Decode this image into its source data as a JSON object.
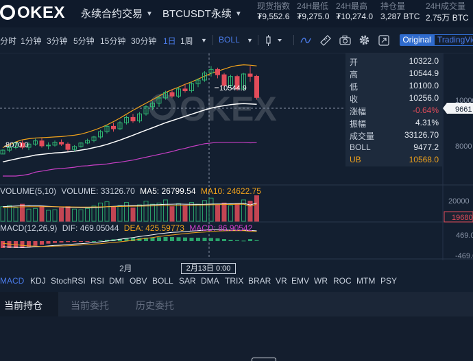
{
  "header": {
    "logo_text": "OKEX",
    "product_menu": "永续合约交易",
    "symbol": "BTCUSDT永续",
    "stats": [
      {
        "label": "现货指数",
        "value": "₮9,552.6"
      },
      {
        "label": "24H最低",
        "value": "₮9,275.0"
      },
      {
        "label": "24H最高",
        "value": "₮10,274.0"
      },
      {
        "label": "持仓量",
        "value": "3,287 BTC"
      },
      {
        "label": "24H成交量",
        "value": "2.75万 BTC"
      }
    ]
  },
  "toolbar": {
    "intervals": [
      "分时",
      "1分钟",
      "3分钟",
      "5分钟",
      "15分钟",
      "30分钟",
      "1日",
      "1周"
    ],
    "active_interval": "1日",
    "indicator": "BOLL",
    "original_label": "Original",
    "tradingview_label": "TradingView"
  },
  "chart": {
    "watermark": "OKEX",
    "high_marker": "10544.9",
    "low_marker": "8070.0",
    "price_tag": "9661",
    "yaxis_labels": [
      "10000",
      "8000"
    ],
    "volume": {
      "label": "VOLUME(5,10)",
      "volume_text": "VOLUME: 33126.70",
      "ma5_text": "MA5: 26799.54",
      "ma10_text": "MA10: 24622.75",
      "axis_label": "20000",
      "tag": "19680"
    },
    "macd": {
      "label": "MACD(12,26,9)",
      "dif_text": "DIF: 469.05044",
      "dea_text": "DEA: 425.59773",
      "macd_text": "MACD: 86.90542",
      "axis_labels": [
        "469.0",
        "-469.0"
      ]
    },
    "xaxis": {
      "month_label": "2月",
      "cursor_label": "2月13日 0:00"
    },
    "colors": {
      "up": "#2fb372",
      "down": "#e24c5a",
      "ub": "#f0a21c",
      "mid": "#ffffff",
      "lb": "#c93fc6",
      "dea": "#f0a21c",
      "macd_label": "#c93fc6"
    }
  },
  "infobox": {
    "rows": [
      {
        "key": "开",
        "value": "10322.0"
      },
      {
        "key": "高",
        "value": "10544.9"
      },
      {
        "key": "低",
        "value": "10100.0"
      },
      {
        "key": "收",
        "value": "10256.0"
      },
      {
        "key": "涨幅",
        "value": "-0.64%"
      },
      {
        "key": "振幅",
        "value": "4.31%"
      },
      {
        "key": "成交量",
        "value": "33126.70"
      },
      {
        "key": "BOLL",
        "value": "9477.2"
      },
      {
        "key": "UB",
        "value": "10568.0"
      }
    ]
  },
  "indicator_tabs": [
    "MACD",
    "KDJ",
    "StochRSI",
    "RSI",
    "DMI",
    "OBV",
    "BOLL",
    "SAR",
    "DMA",
    "TRIX",
    "BRAR",
    "VR",
    "EMV",
    "WR",
    "ROC",
    "MTM",
    "PSY"
  ],
  "bottom_tabs": [
    "当前持仓",
    "当前委托",
    "历史委托"
  ],
  "chart_data": {
    "type": "candlestick",
    "candles": [
      {
        "o": 8070,
        "h": 8200,
        "l": 8070,
        "c": 8180
      },
      {
        "o": 8180,
        "h": 8300,
        "l": 8120,
        "c": 8250
      },
      {
        "o": 8250,
        "h": 8420,
        "l": 8200,
        "c": 8380
      },
      {
        "o": 8380,
        "h": 8450,
        "l": 8200,
        "c": 8260
      },
      {
        "o": 8260,
        "h": 8400,
        "l": 8180,
        "c": 8350
      },
      {
        "o": 8350,
        "h": 8500,
        "l": 8300,
        "c": 8440
      },
      {
        "o": 8440,
        "h": 8520,
        "l": 8250,
        "c": 8300
      },
      {
        "o": 8300,
        "h": 8400,
        "l": 8200,
        "c": 8320
      },
      {
        "o": 8320,
        "h": 8450,
        "l": 8280,
        "c": 8400
      },
      {
        "o": 8400,
        "h": 8480,
        "l": 8300,
        "c": 8350
      },
      {
        "o": 8350,
        "h": 8400,
        "l": 8150,
        "c": 8200
      },
      {
        "o": 8200,
        "h": 8320,
        "l": 8150,
        "c": 8280
      },
      {
        "o": 8280,
        "h": 8400,
        "l": 8250,
        "c": 8380
      },
      {
        "o": 8380,
        "h": 8500,
        "l": 8350,
        "c": 8450
      },
      {
        "o": 8450,
        "h": 8580,
        "l": 8400,
        "c": 8550
      },
      {
        "o": 8550,
        "h": 8750,
        "l": 8500,
        "c": 8700
      },
      {
        "o": 8700,
        "h": 8900,
        "l": 8650,
        "c": 8850
      },
      {
        "o": 8850,
        "h": 8950,
        "l": 8700,
        "c": 8780
      },
      {
        "o": 8780,
        "h": 9000,
        "l": 8750,
        "c": 8950
      },
      {
        "o": 8950,
        "h": 9150,
        "l": 8900,
        "c": 9100
      },
      {
        "o": 9100,
        "h": 9200,
        "l": 8950,
        "c": 9000
      },
      {
        "o": 9000,
        "h": 9250,
        "l": 8950,
        "c": 9200
      },
      {
        "o": 9200,
        "h": 9450,
        "l": 9150,
        "c": 9400
      },
      {
        "o": 9400,
        "h": 9550,
        "l": 9300,
        "c": 9500
      },
      {
        "o": 9500,
        "h": 9700,
        "l": 9400,
        "c": 9650
      },
      {
        "o": 9650,
        "h": 9850,
        "l": 9600,
        "c": 9800
      },
      {
        "o": 9800,
        "h": 9900,
        "l": 9650,
        "c": 9700
      },
      {
        "o": 9700,
        "h": 9950,
        "l": 9650,
        "c": 9900
      },
      {
        "o": 9900,
        "h": 10050,
        "l": 9800,
        "c": 9850
      },
      {
        "o": 9850,
        "h": 10100,
        "l": 9800,
        "c": 10050
      },
      {
        "o": 10050,
        "h": 10200,
        "l": 9950,
        "c": 10150
      },
      {
        "o": 10150,
        "h": 10400,
        "l": 10100,
        "c": 10350
      },
      {
        "o": 10350,
        "h": 10544.9,
        "l": 10250,
        "c": 10450
      },
      {
        "o": 10450,
        "h": 10500,
        "l": 10200,
        "c": 10300
      },
      {
        "o": 10300,
        "h": 10350,
        "l": 9900,
        "c": 10000
      },
      {
        "o": 10000,
        "h": 10300,
        "l": 9950,
        "c": 10250
      },
      {
        "o": 10250,
        "h": 10300,
        "l": 9850,
        "c": 9900
      },
      {
        "o": 9900,
        "h": 10350,
        "l": 9850,
        "c": 10322
      },
      {
        "o": 10322,
        "h": 10544.9,
        "l": 10100,
        "c": 10256
      },
      {
        "o": 10256,
        "h": 10300,
        "l": 9600,
        "c": 9661
      }
    ],
    "boll_mid": [
      7850,
      7890,
      7930,
      7970,
      8000,
      8040,
      8060,
      8080,
      8100,
      8110,
      8130,
      8150,
      8180,
      8210,
      8250,
      8290,
      8340,
      8400,
      8460,
      8530,
      8600,
      8670,
      8740,
      8810,
      8880,
      8950,
      9010,
      9070,
      9130,
      9190,
      9250,
      9310,
      9360,
      9400,
      9430,
      9460,
      9480,
      9490,
      9477,
      9470
    ],
    "boll_ub": [
      8250,
      8330,
      8410,
      8470,
      8500,
      8520,
      8530,
      8540,
      8550,
      8560,
      8580,
      8600,
      8630,
      8680,
      8740,
      8810,
      8890,
      8980,
      9080,
      9190,
      9300,
      9400,
      9500,
      9600,
      9700,
      9800,
      9880,
      9950,
      10030,
      10100,
      10180,
      10260,
      10340,
      10400,
      10460,
      10520,
      10560,
      10580,
      10568,
      10550
    ],
    "boll_lb": [
      7450,
      7450,
      7450,
      7470,
      7500,
      7560,
      7590,
      7620,
      7650,
      7660,
      7680,
      7700,
      7730,
      7740,
      7760,
      7770,
      7790,
      7820,
      7840,
      7870,
      7900,
      7940,
      7980,
      8020,
      8060,
      8100,
      8140,
      8190,
      8230,
      8280,
      8320,
      8360,
      8380,
      8400,
      8400,
      8400,
      8400,
      8400,
      8386,
      8390
    ],
    "volume": [
      24000,
      26000,
      22000,
      28000,
      20000,
      21000,
      25000,
      18000,
      19000,
      22000,
      24000,
      20000,
      19000,
      21000,
      25000,
      30000,
      32000,
      24000,
      26000,
      31000,
      22000,
      27000,
      33000,
      28000,
      30000,
      35000,
      24000,
      29000,
      26000,
      31000,
      28000,
      34000,
      38000,
      27000,
      30000,
      26000,
      29000,
      35000,
      33126.7,
      42000
    ],
    "vol_ma5": [
      24000,
      24500,
      25000,
      25500,
      26000,
      25800,
      25200,
      24500,
      24000,
      23500,
      23000,
      22800,
      22500,
      22300,
      22500,
      23000,
      23800,
      24500,
      25000,
      25500,
      26000,
      26300,
      26800,
      27000,
      27300,
      27800,
      28000,
      28200,
      28000,
      27800,
      27700,
      27800,
      28200,
      28500,
      28500,
      28700,
      29000,
      29500,
      26799.54,
      30000
    ],
    "vol_ma10": [
      23000,
      23200,
      23400,
      23600,
      23800,
      24000,
      24000,
      23900,
      23800,
      23700,
      23600,
      23500,
      23400,
      23400,
      23500,
      23600,
      23800,
      24000,
      24200,
      24400,
      24600,
      24800,
      25000,
      25200,
      25400,
      25600,
      25800,
      26000,
      26200,
      26400,
      26600,
      26800,
      27000,
      27200,
      27400,
      27600,
      27800,
      28000,
      24622.75,
      28300
    ],
    "dif": [
      -250,
      -260,
      -270,
      -280,
      -270,
      -250,
      -230,
      -210,
      -190,
      -170,
      -150,
      -130,
      -110,
      -90,
      -60,
      -30,
      0,
      40,
      80,
      120,
      160,
      200,
      240,
      280,
      320,
      350,
      380,
      400,
      420,
      440,
      460,
      480,
      500,
      500,
      490,
      480,
      470,
      470,
      469.05,
      450
    ],
    "dea": [
      -100,
      -130,
      -160,
      -190,
      -210,
      -220,
      -230,
      -230,
      -220,
      -210,
      -200,
      -185,
      -170,
      -150,
      -130,
      -110,
      -85,
      -60,
      -30,
      0,
      40,
      80,
      120,
      160,
      200,
      240,
      270,
      300,
      330,
      360,
      380,
      400,
      420,
      440,
      450,
      455,
      460,
      462,
      425.6,
      430
    ],
    "macd": [
      -300,
      -300,
      -300,
      -300,
      -250,
      -200,
      -160,
      -110,
      -80,
      -60,
      -40,
      -30,
      -20,
      -10,
      0,
      30,
      60,
      80,
      100,
      120,
      130,
      140,
      150,
      160,
      170,
      180,
      180,
      170,
      160,
      150,
      150,
      150,
      140,
      120,
      90,
      60,
      40,
      20,
      86.9,
      40
    ]
  }
}
